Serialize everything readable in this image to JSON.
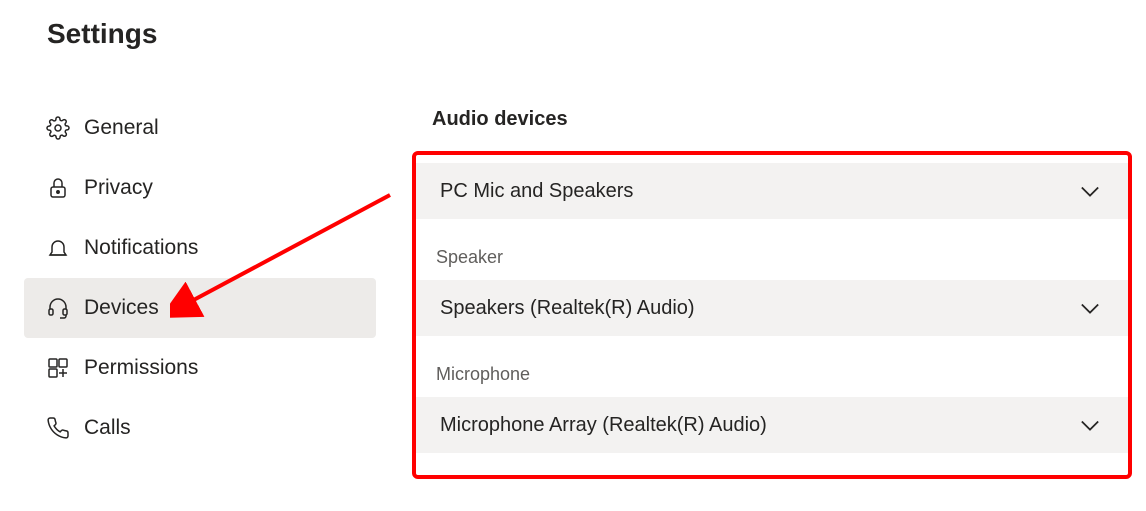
{
  "title": "Settings",
  "sidebar": {
    "items": [
      {
        "label": "General",
        "icon": "gear"
      },
      {
        "label": "Privacy",
        "icon": "lock"
      },
      {
        "label": "Notifications",
        "icon": "bell"
      },
      {
        "label": "Devices",
        "icon": "headset"
      },
      {
        "label": "Permissions",
        "icon": "grid"
      },
      {
        "label": "Calls",
        "icon": "phone"
      }
    ],
    "selected_index": 3
  },
  "content": {
    "section_heading": "Audio devices",
    "profile_label": "",
    "profile_value": "PC Mic and Speakers",
    "speaker_label": "Speaker",
    "speaker_value": "Speakers (Realtek(R) Audio)",
    "microphone_label": "Microphone",
    "microphone_value": "Microphone Array (Realtek(R) Audio)"
  },
  "annotation": {
    "color": "#ff0000"
  }
}
